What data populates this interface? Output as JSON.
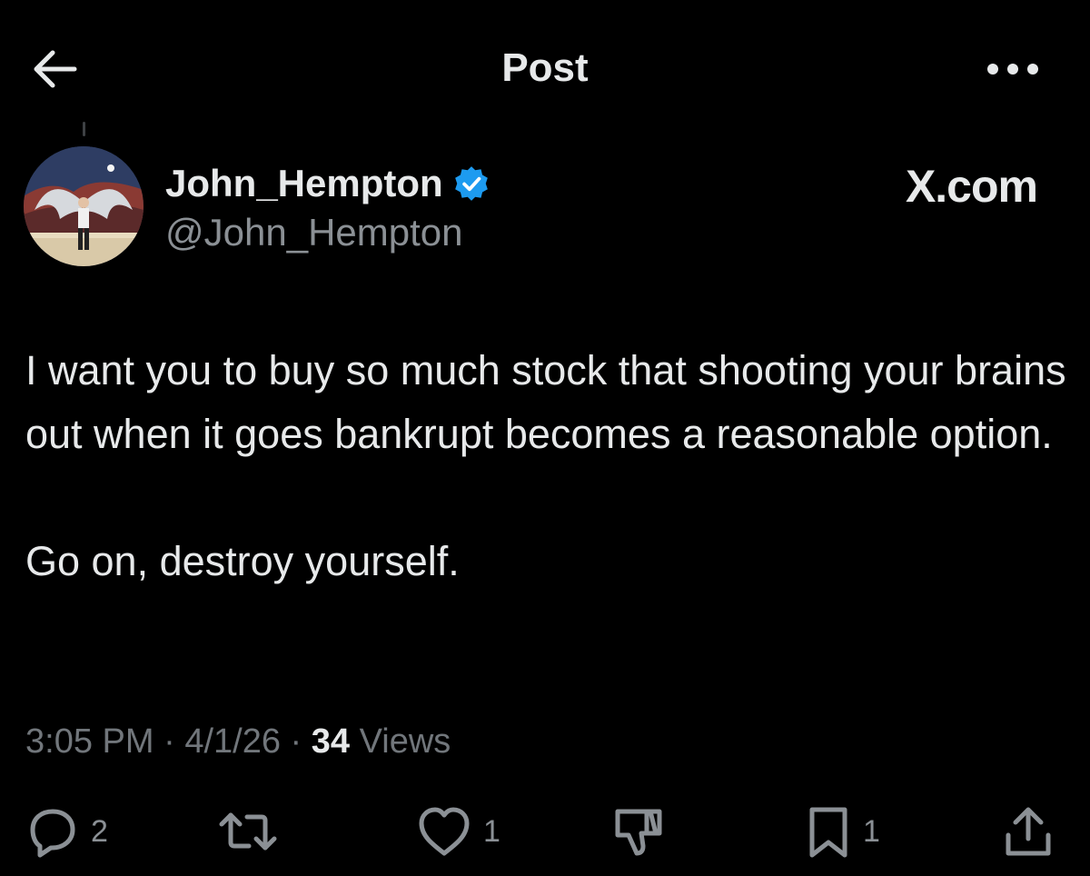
{
  "header": {
    "title": "Post"
  },
  "post": {
    "display_name": "John_Hempton",
    "handle": "@John_Hempton",
    "site": "X.com",
    "text_paragraphs": [
      "I want you to buy so much stock that shooting your brains out when it goes bankrupt becomes a reasonable option.",
      "Go on, destroy yourself."
    ],
    "time": "3:05 PM",
    "date": "4/1/26",
    "views_count": "34",
    "views_label": "Views",
    "separator": "·"
  },
  "actions": {
    "replies": "2",
    "reposts": "",
    "likes": "1",
    "bookmarks": "1"
  },
  "colors": {
    "background": "#000000",
    "text": "#e7e9ea",
    "muted": "#71767b",
    "verified": "#1d9bf0"
  },
  "icons": [
    "back-arrow-icon",
    "more-icon",
    "verified-badge-icon",
    "reply-icon",
    "repost-icon",
    "like-icon",
    "dislike-icon",
    "bookmark-icon",
    "share-icon"
  ]
}
